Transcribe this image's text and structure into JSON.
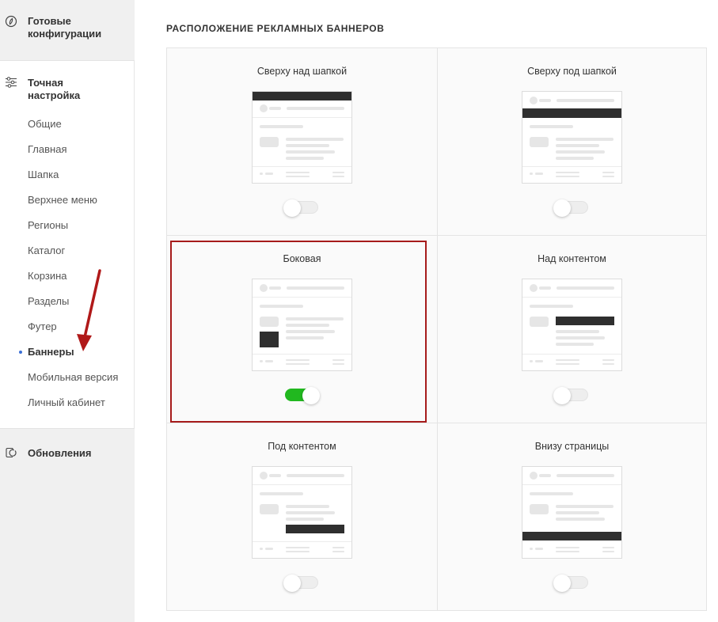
{
  "sidebar": {
    "ready_configs_label": "Готовые\nконфигурации",
    "ready_icon": "compass-icon",
    "fine_tuning_label": "Точная\nнастройка",
    "fine_tuning_icon": "sliders-icon",
    "items": [
      {
        "label": "Общие"
      },
      {
        "label": "Главная"
      },
      {
        "label": "Шапка"
      },
      {
        "label": "Верхнее меню"
      },
      {
        "label": "Регионы"
      },
      {
        "label": "Каталог"
      },
      {
        "label": "Корзина"
      },
      {
        "label": "Разделы"
      },
      {
        "label": "Футер"
      },
      {
        "label": "Баннеры",
        "active": true
      },
      {
        "label": "Мобильная версия"
      },
      {
        "label": "Личный кабинет"
      }
    ],
    "updates_label": "Обновления",
    "updates_icon": "update-icon"
  },
  "main": {
    "title": "РАСПОЛОЖЕНИЕ РЕКЛАМНЫХ БАННЕРОВ",
    "options": [
      {
        "label": "Сверху над шапкой",
        "enabled": false,
        "banner_position": "above-header"
      },
      {
        "label": "Сверху под шапкой",
        "enabled": false,
        "banner_position": "below-header"
      },
      {
        "label": "Боковая",
        "enabled": true,
        "banner_position": "side",
        "highlighted": true
      },
      {
        "label": "Над контентом",
        "enabled": false,
        "banner_position": "above-content"
      },
      {
        "label": "Под контентом",
        "enabled": false,
        "banner_position": "below-content"
      },
      {
        "label": "Внизу страницы",
        "enabled": false,
        "banner_position": "page-bottom"
      }
    ]
  },
  "colors": {
    "toggle_on": "#21b81f",
    "highlight_border": "#a61b1b",
    "arrow": "#b01919",
    "active_dot": "#3b6fd6"
  }
}
